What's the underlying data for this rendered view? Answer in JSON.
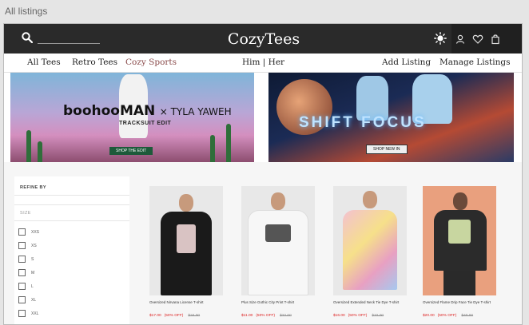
{
  "window": {
    "title": "All listings"
  },
  "header": {
    "brand": "CozyTees"
  },
  "nav": {
    "left": [
      "All Tees",
      "Retro Tees",
      "Cozy Sports"
    ],
    "center": "Him | Her",
    "right": [
      "Add Listing",
      "Manage Listings"
    ]
  },
  "banners": {
    "left": {
      "brand": "boohooMAN",
      "collab": "× TYLA YAWEH",
      "subtitle": "TRACKSUIT EDIT",
      "cta": "SHOP THE EDIT"
    },
    "right": {
      "title": "SHIFT FOCUS",
      "cta": "SHOP NEW IN"
    }
  },
  "sidebar": {
    "heading": "REFINE BY",
    "size_label": "SIZE",
    "sizes": [
      "XXS",
      "XS",
      "S",
      "M",
      "L",
      "XL",
      "XXL"
    ]
  },
  "products": [
    {
      "title": "Oversized Nirvana License T-shirt",
      "price": "$17.00",
      "discount": "(50% OFF)",
      "was": "$34.00",
      "shirt_color": "#1a1a1a",
      "backdrop": "#ececec"
    },
    {
      "title": "Plus Size Gothic City Print T-shirt",
      "price": "$11.00",
      "discount": "(50% OFF)",
      "was": "$22.00",
      "shirt_color": "#f4f4f4",
      "backdrop": "#e9e9e9"
    },
    {
      "title": "Oversized Extended Neck Tie Dye T-shirt",
      "price": "$16.00",
      "discount": "(50% OFF)",
      "was": "$32.00",
      "shirt_color": "#e9a7b8",
      "backdrop": "#e6e6e6"
    },
    {
      "title": "Oversized Flame Drip Face Tie Dye T-shirt",
      "price": "$20.00",
      "discount": "(50% OFF)",
      "was": "$40.00",
      "shirt_color": "#2b2b2b",
      "backdrop": "#e9a07e"
    }
  ]
}
